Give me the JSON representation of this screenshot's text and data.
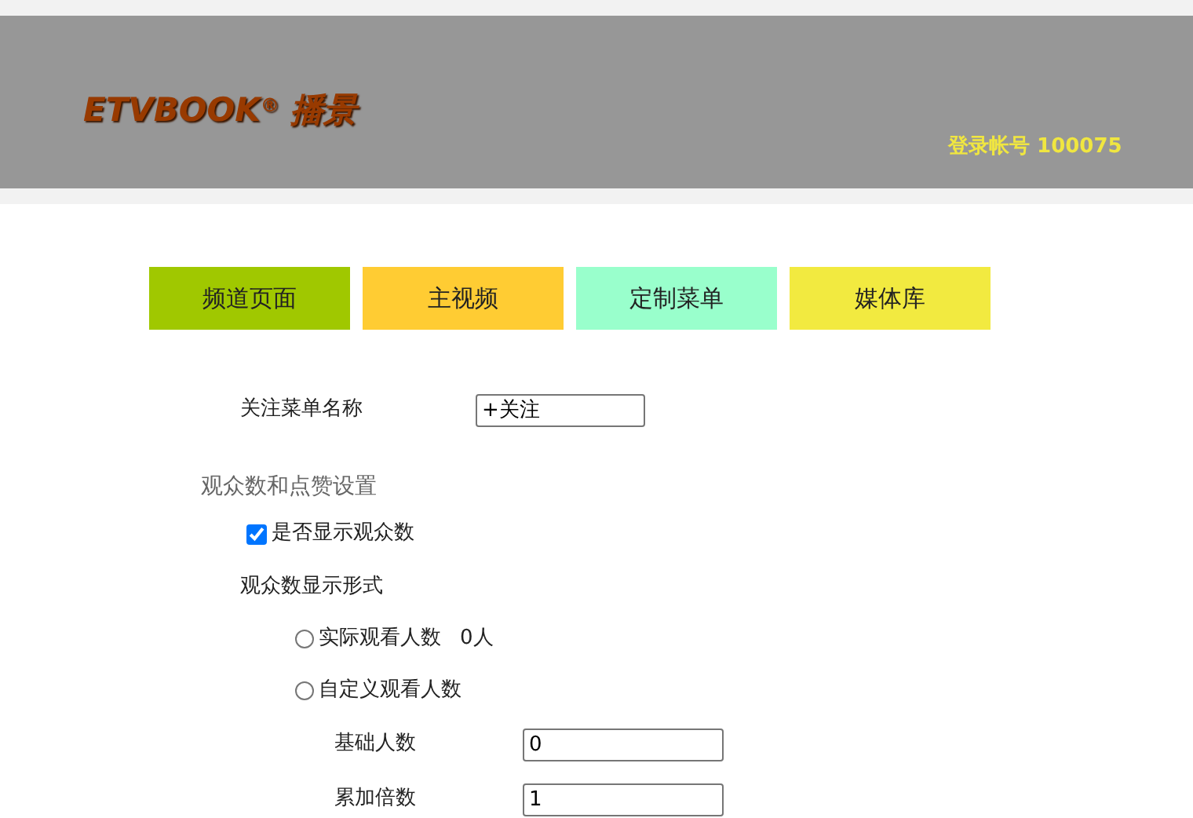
{
  "header": {
    "logo": "ETVBOOK$^{®}$ 播景",
    "account": "登录帐号 100075"
  },
  "tabs": [
    {
      "label": "频道页面",
      "color": "#a0c800"
    },
    {
      "label": "主视频",
      "color": "#ffcc33"
    },
    {
      "label": "定制菜单",
      "color": "#99ffcc"
    },
    {
      "label": "媒体库",
      "color": "#f2ea40"
    }
  ],
  "follow_menu": {
    "label": "关注菜单名称",
    "value": "+关注"
  },
  "section_title": "观众数和点赞设置",
  "show_viewers": {
    "label": "是否显示观众数",
    "checked": true
  },
  "display_mode": {
    "label": "观众数显示形式",
    "options": [
      {
        "label": "实际观看人数",
        "selected": false,
        "count": "0人"
      },
      {
        "label": "自定义观看人数",
        "selected": false
      }
    ]
  },
  "fields": [
    {
      "label": "基础人数",
      "value": "0"
    },
    {
      "label": "累加倍数",
      "value": "1"
    }
  ]
}
